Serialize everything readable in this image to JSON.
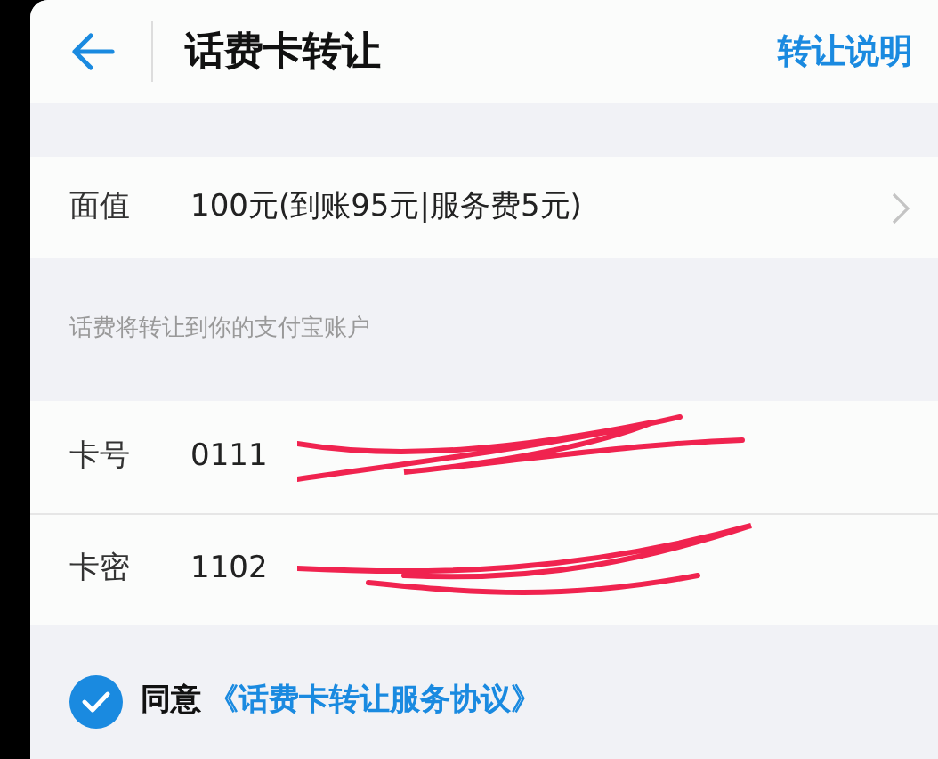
{
  "header": {
    "title": "话费卡转让",
    "action": "转让说明"
  },
  "face_value": {
    "label": "面值",
    "value": "100元(到账95元|服务费5元)"
  },
  "note": "话费将转让到你的支付宝账户",
  "fields": [
    {
      "label": "卡号",
      "value": "0111",
      "redacted": true
    },
    {
      "label": "卡密",
      "value": "1102",
      "redacted": true
    }
  ],
  "agreement": {
    "checked": true,
    "text": "同意",
    "link": "《话费卡转让服务协议》"
  }
}
